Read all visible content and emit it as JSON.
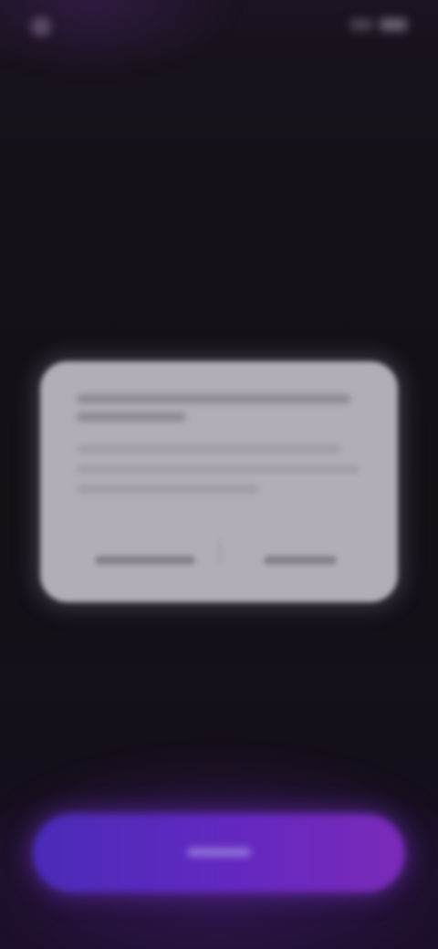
{
  "status_bar": {
    "time": "",
    "app_icon": "app-icon",
    "signal_icon": "signal-icon",
    "battery_icon": "battery-icon"
  },
  "header": {
    "link_label": "",
    "title": ""
  },
  "dialog": {
    "title": "",
    "body": "",
    "cancel_label": "",
    "confirm_label": ""
  },
  "primary_button": {
    "label": ""
  },
  "colors": {
    "background": "#141016",
    "dialog_background": "#b2adb6",
    "accent_gradient_start": "#4a2bb8",
    "accent_gradient_end": "#7b2ab8"
  }
}
